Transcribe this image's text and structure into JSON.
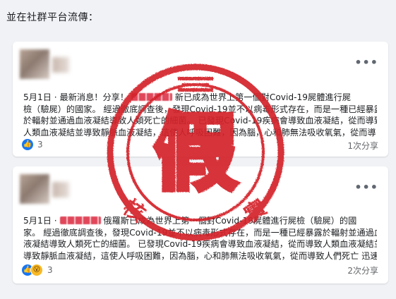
{
  "intro_text": "並在社群平台流傳：",
  "posts": [
    {
      "date": "5月1日",
      "lines": [
        [
          "· 最新消息！分享！",
          "新已成為世界上第一個對Covid-19屍體進行屍"
        ],
        [
          "檢（驗屍）的國家。 經過徹底調查後，發現Covid-19並不以病毒形式存在，而是一種已經暴露"
        ],
        [
          "於輻射並通過血液凝結導致人類死亡的細菌。 已發現Covid-19疾病會導致血液凝結，從而導致"
        ],
        [
          "人類血液凝結並導致靜脈血液凝結，這使人呼吸困難，因為腦，心和肺無法吸收氧氣，從而導"
        ]
      ],
      "reaction_count": "3",
      "shares": "1次分享"
    },
    {
      "date": "5月1日",
      "lines": [
        [
          "· ",
          "俄羅斯已成為世界上第一個對Covid-19屍體進行屍檢（驗屍）的國"
        ],
        [
          "家。 經過徹底調查後，發現Covid-19並不以病毒形式存在，而是一種已經暴露於輻射並通過血"
        ],
        [
          "液凝結導致人類死亡的細菌。 已發現Covid-19疾病會導致血液凝結，從而導致人類血液凝結並"
        ],
        [
          "導致靜脈血液凝結，這使人呼吸困難，因為腦，心和肺無法吸收氧氣，從而導致人們死亡 迅速..."
        ]
      ],
      "reaction_count": "3",
      "shares": "2次分享"
    }
  ],
  "stamp": {
    "center_char": "假",
    "bottom_left_char": "核",
    "bottom_right_char": "實",
    "color": "#d4242c"
  },
  "icons": {
    "more": "more-options-icon",
    "globe": "globe-icon",
    "like": "like-icon",
    "wow": "wow-icon"
  },
  "colors": {
    "background": "#f0f2f5",
    "like_blue": "#1877f2",
    "stamp_red": "#d4242c"
  }
}
